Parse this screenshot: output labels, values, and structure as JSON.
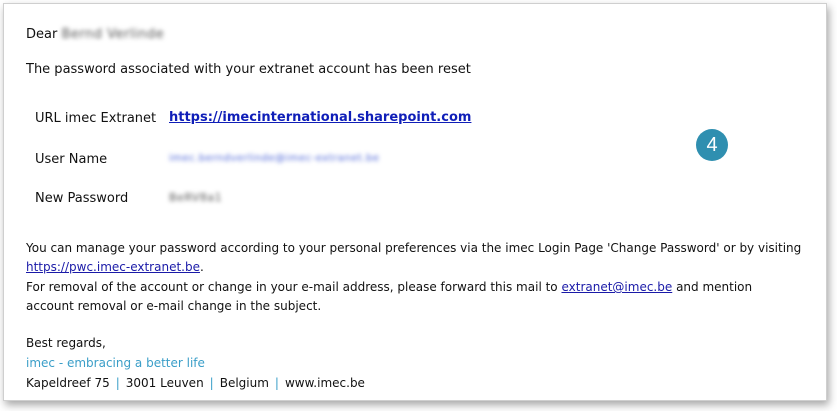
{
  "email": {
    "greeting": "Dear",
    "greeting_name": "Bernd Verlinde",
    "intro": "The password associated with your extranet account has been reset",
    "fields": {
      "url_label": "URL imec Extranet",
      "url_value": "https://imecinternational.sharepoint.com",
      "username_label": "User Name",
      "username_value": "imec.berndverlinde@imec-extranet.be",
      "password_label": "New Password",
      "password_value": "BeRV8a1"
    },
    "manage_text": "You can manage your password according to your personal preferences via the imec Login Page 'Change Password' or by visiting",
    "manage_link": "https://pwc.imec-extranet.be",
    "manage_end": ".",
    "removal_text": "For removal of the account or change in your e-mail address, please forward this mail to",
    "removal_email": "extranet@imec.be",
    "removal_end": "and mention",
    "removal_line2": "account removal or e-mail change in the subject.",
    "closing": "Best regards,",
    "tagline": "imec - embracing a better life",
    "address": {
      "street": "Kapeldreef 75",
      "city": "3001 Leuven",
      "country": "Belgium",
      "website": "www.imec.be",
      "separator": "|"
    }
  },
  "badge": {
    "number": "4",
    "color": "#2f8fb0"
  }
}
